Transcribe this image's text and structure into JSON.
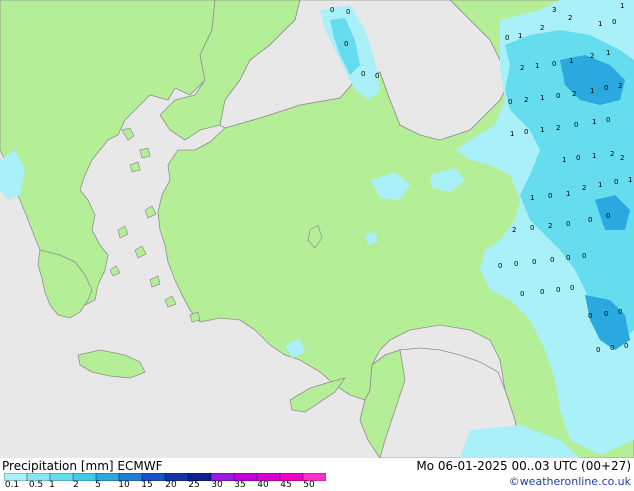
{
  "footer": {
    "product": "Precipitation [mm]",
    "model": "ECMWF",
    "valid_time": "Mo 06-01-2025 00..03 UTC (00+27)",
    "credit": "©weatheronline.co.uk"
  },
  "legend": {
    "ticks": [
      "0.1",
      "0.5",
      "1",
      "2",
      "5",
      "10",
      "15",
      "20",
      "25",
      "30",
      "35",
      "40",
      "45",
      "50"
    ],
    "colors": [
      "#aaf0f8",
      "#88e6f2",
      "#66dcef",
      "#44c9e8",
      "#2aa8e0",
      "#1f7fd6",
      "#1a52c8",
      "#1534a8",
      "#102090",
      "#9a1ae0",
      "#c000d8",
      "#d800d0",
      "#ee00c8",
      "#ff33cc"
    ]
  },
  "map_colors": {
    "sea": "#e8e8e8",
    "land": "#b4ee96",
    "coast": "#909090",
    "precip_light": "#aaf0f8",
    "precip_medium": "#66dcef",
    "precip_heavy": "#2aa8e0"
  },
  "point_values": [
    "0",
    "1",
    "2",
    "3",
    "2",
    "1",
    "0",
    "1",
    "2",
    "1",
    "0",
    "1",
    "2",
    "1",
    "0",
    "2",
    "1",
    "0",
    "2",
    "1",
    "0",
    "2",
    "1",
    "0",
    "1",
    "2",
    "0",
    "1",
    "0",
    "2",
    "1",
    "0",
    "1",
    "2",
    "1",
    "0",
    "1",
    "2",
    "1",
    "0",
    "1",
    "2",
    "0",
    "2",
    "0",
    "0",
    "0",
    "0",
    "0",
    "0",
    "0",
    "0",
    "0",
    "0",
    "0",
    "0",
    "0",
    "0",
    "0",
    "0",
    "0",
    "0",
    "0",
    "0",
    "0",
    "0",
    "0",
    "0"
  ]
}
